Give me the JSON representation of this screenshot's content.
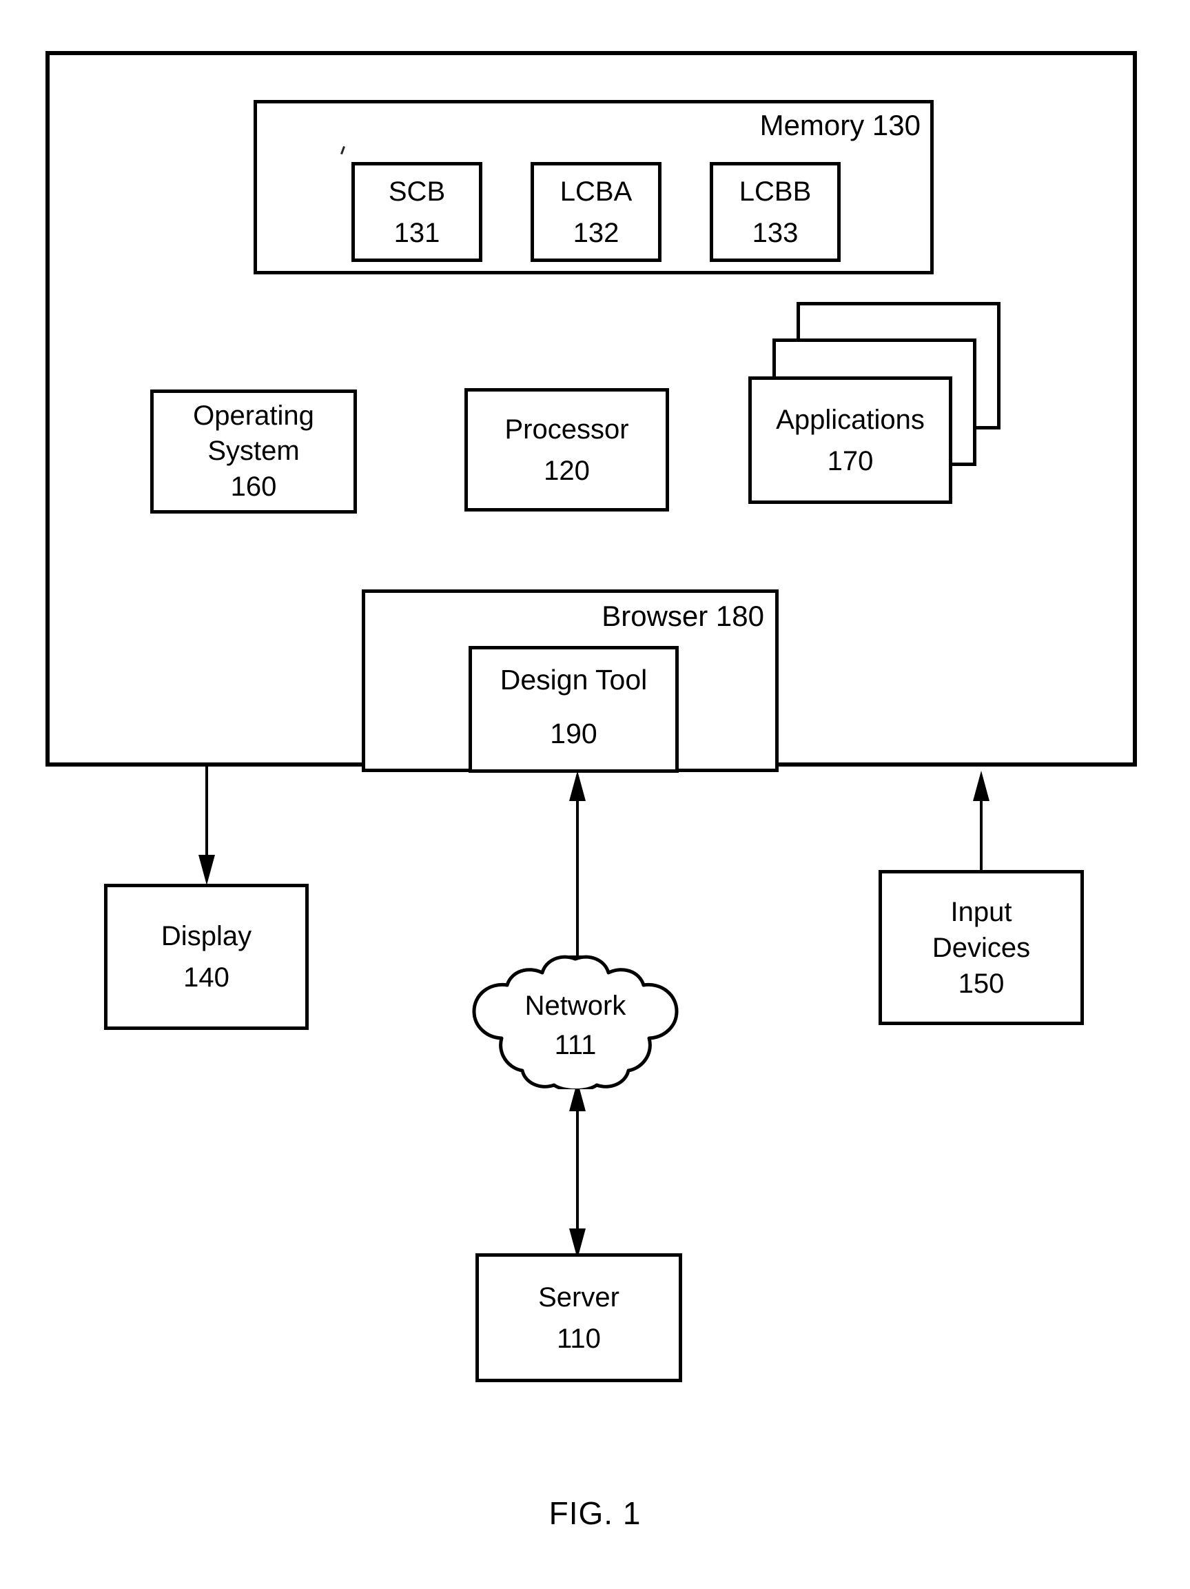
{
  "figure": {
    "caption": "FIG. 1",
    "ink_color": "#000000",
    "background_color": "#ffffff"
  },
  "system": {
    "memory": {
      "label": "Memory 130",
      "cells": [
        {
          "name": "SCB",
          "ref": "131"
        },
        {
          "name": "LCBA",
          "ref": "132"
        },
        {
          "name": "LCBB",
          "ref": "133"
        }
      ]
    },
    "operating_system": {
      "line1": "Operating",
      "line2": "System",
      "ref": "160"
    },
    "processor": {
      "line1": "Processor",
      "ref": "120"
    },
    "applications": {
      "line1": "Applications",
      "ref": "170",
      "stack_layers": 3
    },
    "browser": {
      "label": "Browser 180"
    },
    "design_tool": {
      "line1": "Design Tool",
      "ref": "190"
    }
  },
  "peripherals": {
    "display": {
      "line1": "Display",
      "ref": "140"
    },
    "input_devices": {
      "line1": "Input",
      "line2": "Devices",
      "ref": "150"
    }
  },
  "network": {
    "line1": "Network",
    "ref": "111"
  },
  "server": {
    "line1": "Server",
    "ref": "110"
  },
  "connections": [
    {
      "from": "system",
      "to": "display",
      "direction": "down"
    },
    {
      "from": "system",
      "to": "network",
      "direction": "bidirectional"
    },
    {
      "from": "input_devices",
      "to": "system",
      "direction": "up"
    },
    {
      "from": "server",
      "to": "network",
      "direction": "bidirectional"
    }
  ]
}
